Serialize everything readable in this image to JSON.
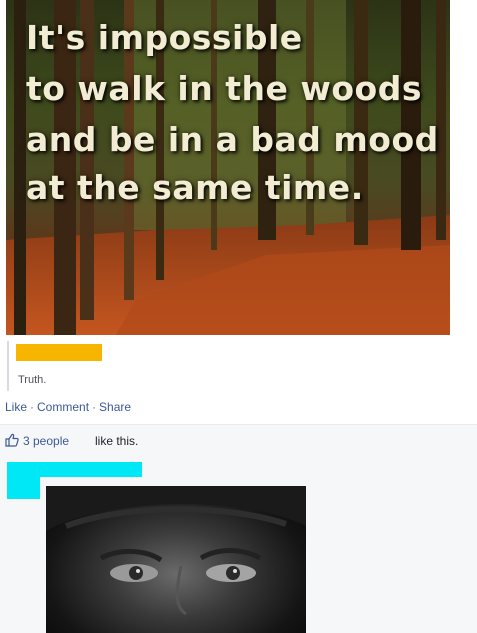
{
  "post": {
    "quote_lines": [
      "It's impossible",
      "to walk in the woods",
      "and be in a bad mood",
      "at the same time."
    ],
    "caption": "Truth.",
    "colors": {
      "redaction_orange": "#f7b500",
      "redaction_cyan": "#00e7f5",
      "link_blue": "#3b5998"
    }
  },
  "actions": {
    "like": "Like",
    "comment": "Comment",
    "share": "Share",
    "separator": "·"
  },
  "likes": {
    "icon": "thumbs-up-icon",
    "count_link": "3 people",
    "suffix": "like this."
  },
  "comment": {
    "avatar": "redacted-avatar",
    "photo": "close-up-face-photo"
  }
}
